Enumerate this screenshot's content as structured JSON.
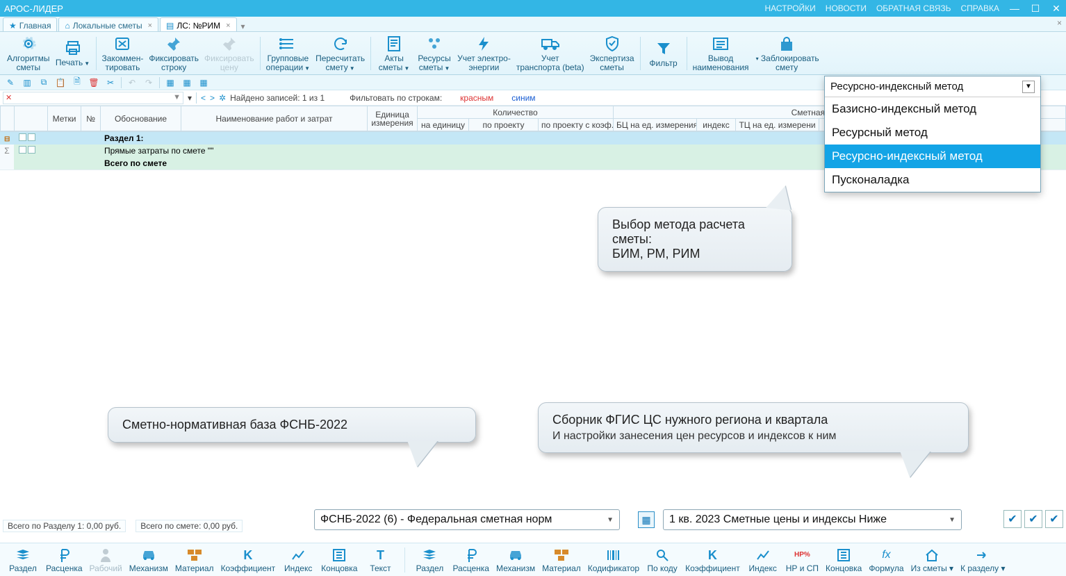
{
  "app": {
    "title": "АРОС-ЛИДЕР"
  },
  "topmenu": {
    "settings": "НАСТРОЙКИ",
    "news": "НОВОСТИ",
    "feedback": "ОБРАТНАЯ СВЯЗЬ",
    "help": "СПРАВКА"
  },
  "tabs": {
    "t1": "Главная",
    "t2": "Локальные сметы",
    "t3": "ЛС: №РИМ"
  },
  "ribbon": {
    "algorithms": "Алгоритмы\nсметы",
    "print": "Печать",
    "comment": "Закоммен-\nтировать",
    "fixrow": "Фиксировать\nстроку",
    "fixprice": "Фиксировать\nцену",
    "groupops": "Групповые\nоперации",
    "recalc": "Пересчитать\nсмету",
    "acts": "Акты\nсметы",
    "resources": "Ресурсы\nсметы",
    "electro": "Учет электро-\nэнергии",
    "transport": "Учет\nтранспорта (beta)",
    "expertise": "Экспертиза\nсметы",
    "filter": "Фильтр",
    "nameout": "Вывод\nнаименования",
    "lock": "Заблокировать\nсмету"
  },
  "found": {
    "label": "Найдено записей: 1 из 1",
    "filterlabel": "Фильтовать по строкам:",
    "red": "красным",
    "blue": "синим"
  },
  "grid": {
    "h_marks": "Метки",
    "h_no": "№",
    "h_justif": "Обоснование",
    "h_name": "Наименование работ и затрат",
    "h_unit": "Единица\nизмерения",
    "h_qty": "Количество",
    "h_qty1": "на единицу",
    "h_qty2": "по проекту",
    "h_qty3": "по проекту с коэф.",
    "h_cost": "Сметная стоимость, руб.",
    "h_cost1": "БЦ на ед. измерения",
    "h_cost2": "индекс",
    "h_cost3": "ТЦ на ед. измерени",
    "r_section": "Раздел 1:",
    "r_direct": "Прямые затраты по смете \"\"",
    "r_total": "Всего по смете"
  },
  "method": {
    "selected": "Ресурсно-индексный метод",
    "o1": "Базисно-индексный метод",
    "o2": "Ресурсный метод",
    "o3": "Ресурсно-индексный метод",
    "o4": "Пусконаладка"
  },
  "bubbles": {
    "b1a": "Выбор метода расчета",
    "b1b": "сметы:",
    "b1c": "БИМ, РМ, РИМ",
    "b2": "Сметно-нормативная база ФСНБ-2022",
    "b3a": "Сборник ФГИС ЦС нужного региона и квартала",
    "b3b": "И настройки  занесения цен ресурсов и индексов к ним"
  },
  "status": {
    "s1": "Всего по Разделу 1: 0,00 руб.",
    "s2": "Всего по смете: 0,00 руб."
  },
  "bottomsel": {
    "s1": "ФСНБ-2022 (6) - Федеральная сметная норм",
    "s2": "1 кв. 2023 Сметные цены и индексы Ниже"
  },
  "bottombar": {
    "i1": "Раздел",
    "i2": "Расценка",
    "i3": "Рабочий",
    "i4": "Механизм",
    "i5": "Материал",
    "i6": "Коэффициент",
    "i7": "Индекс",
    "i8": "Концовка",
    "i9": "Текст",
    "i10": "Раздел",
    "i11": "Расценка",
    "i12": "Механизм",
    "i13": "Материал",
    "i14": "Кодификатор",
    "i15": "По коду",
    "i16": "Коэффициент",
    "i17": "Индекс",
    "i18": "НР и СП",
    "i19": "Концовка",
    "i20": "Формула",
    "i21": "Из сметы",
    "i22": "К разделу"
  }
}
